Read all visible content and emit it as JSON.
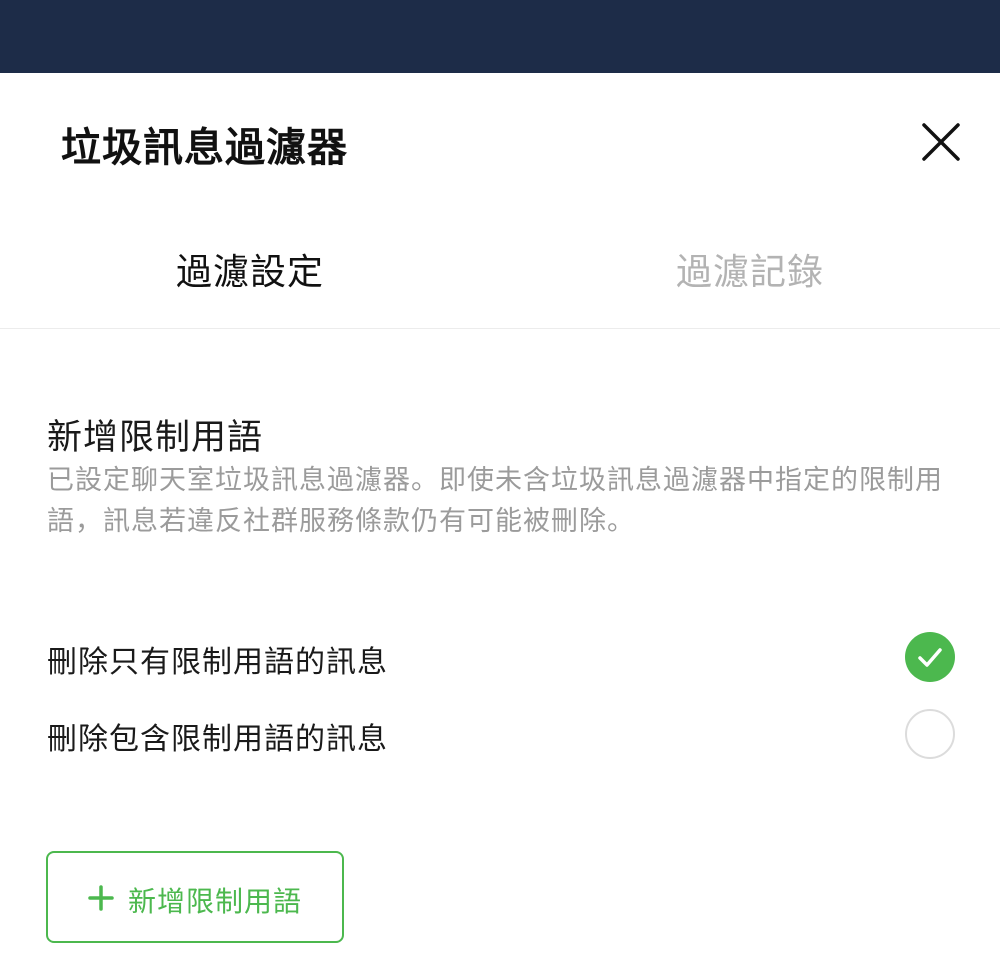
{
  "header": {
    "title": "垃圾訊息過濾器",
    "close_icon": "close-icon"
  },
  "tabs": [
    {
      "label": "過濾設定",
      "active": true
    },
    {
      "label": "過濾記錄",
      "active": false
    }
  ],
  "section": {
    "title": "新增限制用語",
    "description": "已設定聊天室垃圾訊息過濾器。即使未含垃圾訊息過濾器中指定的限制用語，訊息若違反社群服務條款仍有可能被刪除。"
  },
  "options": [
    {
      "label": "刪除只有限制用語的訊息",
      "selected": true
    },
    {
      "label": "刪除包含限制用語的訊息",
      "selected": false
    }
  ],
  "add_button": {
    "label": "新增限制用語",
    "icon": "plus-icon"
  },
  "colors": {
    "topbar": "#1d2c48",
    "accent": "#4cb84e",
    "inactive_tab": "#b3b3b3",
    "description": "#9b9b9b"
  }
}
